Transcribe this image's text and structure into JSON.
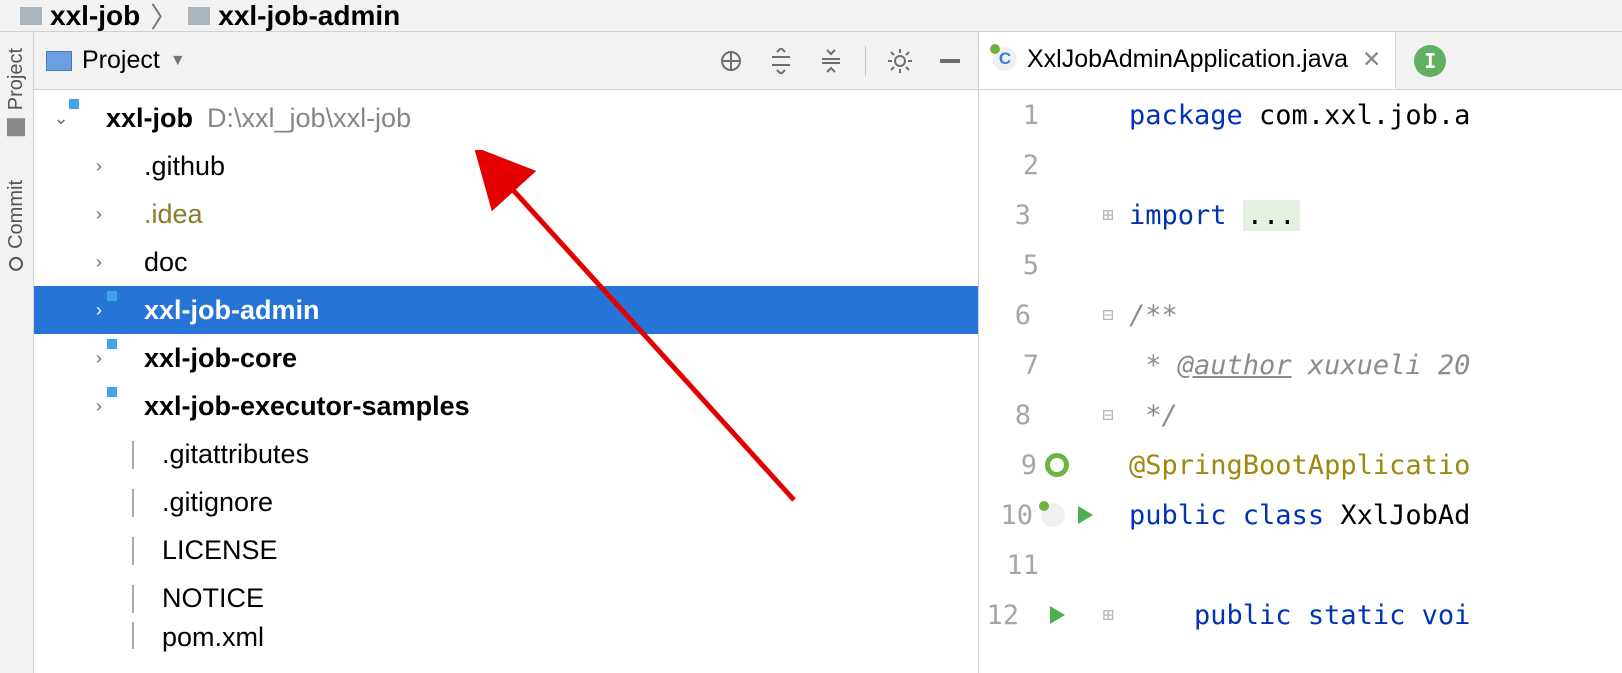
{
  "breadcrumb": {
    "item1": "xxl-job",
    "item2": "xxl-job-admin"
  },
  "sidebar_tabs": {
    "project": "Project",
    "commit": "Commit"
  },
  "project_panel": {
    "title": "Project"
  },
  "tree": {
    "root": {
      "name": "xxl-job",
      "path": "D:\\xxl_job\\xxl-job"
    },
    "children": [
      {
        "name": ".github",
        "kind": "folder"
      },
      {
        "name": ".idea",
        "kind": "idea"
      },
      {
        "name": "doc",
        "kind": "folder"
      },
      {
        "name": "xxl-job-admin",
        "kind": "module",
        "selected": true
      },
      {
        "name": "xxl-job-core",
        "kind": "module"
      },
      {
        "name": "xxl-job-executor-samples",
        "kind": "module"
      },
      {
        "name": ".gitattributes",
        "kind": "file"
      },
      {
        "name": ".gitignore",
        "kind": "gitignore"
      },
      {
        "name": "LICENSE",
        "kind": "file"
      },
      {
        "name": "NOTICE",
        "kind": "file"
      },
      {
        "name": "pom.xml",
        "kind": "pom",
        "partial": true
      }
    ]
  },
  "editor": {
    "tab_title": "XxlJobAdminApplication.java",
    "run_badge": "I",
    "lines": {
      "l1": "package com.xxl.job.a",
      "l3_kw": "import ",
      "l3_dots": "...",
      "l6": "/**",
      "l7_a": " * ",
      "l7_tag": "@author",
      "l7_b": " xuxueli 20",
      "l8": " */",
      "l9": "@SpringBootApplicatio",
      "l10_a": "public ",
      "l10_b": "class ",
      "l10_c": "XxlJobAd",
      "l12_a": "public ",
      "l12_b": "static ",
      "l12_c": "voi"
    },
    "line_numbers": [
      "1",
      "2",
      "3",
      "5",
      "6",
      "7",
      "8",
      "9",
      "10",
      "11",
      "12"
    ]
  }
}
